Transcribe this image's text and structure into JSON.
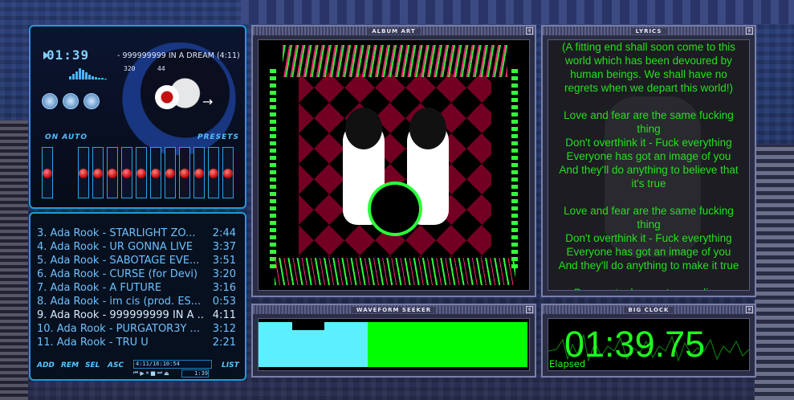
{
  "player": {
    "time": "01:39",
    "marquee": "- 999999999 IN A DREAM (4:11)",
    "kbps": "320",
    "khz": "44",
    "eq_auto_label": "ON  AUTO",
    "eq_presets_label": "PRESETS",
    "eq_bands": [
      0.6,
      0.6,
      0.6,
      0.6,
      0.6,
      0.6,
      0.6,
      0.6,
      0.6,
      0.6,
      0.6
    ],
    "preamp": 0.5
  },
  "playlist": {
    "items": [
      {
        "title": "3. Ada Rook - STARLIGHT ZO...",
        "duration": "2:44",
        "current": false
      },
      {
        "title": "4. Ada Rook - UR GONNA LIVE",
        "duration": "3:37",
        "current": false
      },
      {
        "title": "5. Ada Rook - SABOTAGE EVE...",
        "duration": "3:51",
        "current": false
      },
      {
        "title": "6. Ada Rook - CURSE (for Devi)",
        "duration": "3:20",
        "current": false
      },
      {
        "title": "7. Ada Rook - A FUTURE",
        "duration": "3:16",
        "current": false
      },
      {
        "title": "8. Ada Rook - im cis (prod. ES...",
        "duration": "0:53",
        "current": false
      },
      {
        "title": "9. Ada Rook - 999999999 IN A ...",
        "duration": "4:11",
        "current": true
      },
      {
        "title": "10. Ada Rook - PURGATOR3Y ...",
        "duration": "3:12",
        "current": false
      },
      {
        "title": "11. Ada Rook - TRU U",
        "duration": "2:21",
        "current": false
      }
    ],
    "buttons": {
      "add": "ADD",
      "rem": "REM",
      "sel": "SEL",
      "misc": "ASC",
      "list": "LIST"
    },
    "info": "4:11/16:10:54",
    "mini_time": "1:39"
  },
  "panels": {
    "album_art_title": "ALBUM ART",
    "lyrics_title": "LYRICS",
    "waveform_title": "WAVEFORM SEEKER",
    "clock_title": "BIG CLOCK"
  },
  "lyrics": [
    "(A fitting end shall soon come to this",
    "world which has been devoured by",
    "human beings. We shall have no",
    "regrets when we depart this world!)",
    "",
    "Love and fear are the same fucking",
    "thing",
    "Don't overthink it - Fuck everything",
    "Everyone has got an image of you",
    "And they'll do anything to believe that",
    "it's true",
    "",
    "Love and fear are the same fucking",
    "thing",
    "Don't overthink it - Fuck everything",
    "Everyone has got an image of you",
    "And they'll do anything to make it true",
    "",
    "Desperate desperate paradigm"
  ],
  "waveform": {
    "progress": 0.4,
    "played_color": "#5cf0ff",
    "unplayed_color": "#00ff00"
  },
  "clock": {
    "time": "01:39.75",
    "label": "Elapsed",
    "color": "#1fff1f"
  }
}
